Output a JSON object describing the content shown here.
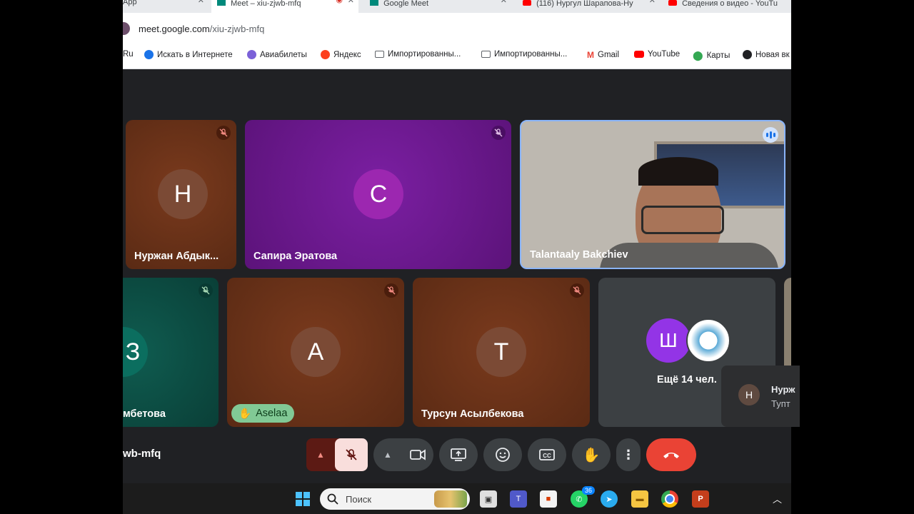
{
  "browser": {
    "tabs": [
      {
        "title": "App"
      },
      {
        "title": "Meet – xiu-zjwb-mfq"
      },
      {
        "title": "Google Meet"
      },
      {
        "title": "(116) Нургул Шарапова-Ну"
      },
      {
        "title": "Сведения о видео - YouTu"
      }
    ],
    "url_domain": "meet.google.com",
    "url_path": "/xiu-zjwb-mfq",
    "bookmarks": [
      {
        "label": "Ru",
        "icon": "site-icon"
      },
      {
        "label": "Искать в Интернете",
        "icon": "search-site-icon"
      },
      {
        "label": "Авиабилеты",
        "icon": "plane-icon"
      },
      {
        "label": "Яндекс",
        "icon": "yandex-icon"
      },
      {
        "label": "Импортированны...",
        "icon": "folder-icon"
      },
      {
        "label": "Импортированны...",
        "icon": "folder-icon"
      },
      {
        "label": "Gmail",
        "icon": "gmail-icon"
      },
      {
        "label": "YouTube",
        "icon": "youtube-icon"
      },
      {
        "label": "Карты",
        "icon": "maps-icon"
      },
      {
        "label": "Новая вк",
        "icon": "globe-icon"
      }
    ]
  },
  "meet": {
    "meeting_code_partial": "wb-mfq",
    "participants": [
      {
        "name": "Нуржан Абдык...",
        "initial": "Н",
        "muted": true
      },
      {
        "name": "Сапира Эратова",
        "initial": "С",
        "muted": true
      },
      {
        "name": "Talantaaly Bakchiev",
        "speaking": true
      },
      {
        "name": "мбетова",
        "initial": "З",
        "muted": true
      },
      {
        "name": "",
        "initial": "А",
        "muted": true,
        "raised_hand_label": "Aselaa"
      },
      {
        "name": "Турсун Асылбекова",
        "initial": "Т",
        "muted": true
      }
    ],
    "others": {
      "initial": "Ш",
      "label": "Ещё 14 чел."
    },
    "notification": {
      "initial": "Н",
      "title": "Нурж",
      "subtitle": "Тупт"
    }
  },
  "taskbar": {
    "search_placeholder": "Поиск",
    "whatsapp_badge": "36"
  },
  "colors": {
    "meet_bg": "#202124",
    "end_call": "#ea4335",
    "muted_mic_bg": "#f9dedc",
    "purple_tile": "#6a1b9a",
    "brown_tile": "#6d3219",
    "teal_tile": "#0b4a40"
  }
}
